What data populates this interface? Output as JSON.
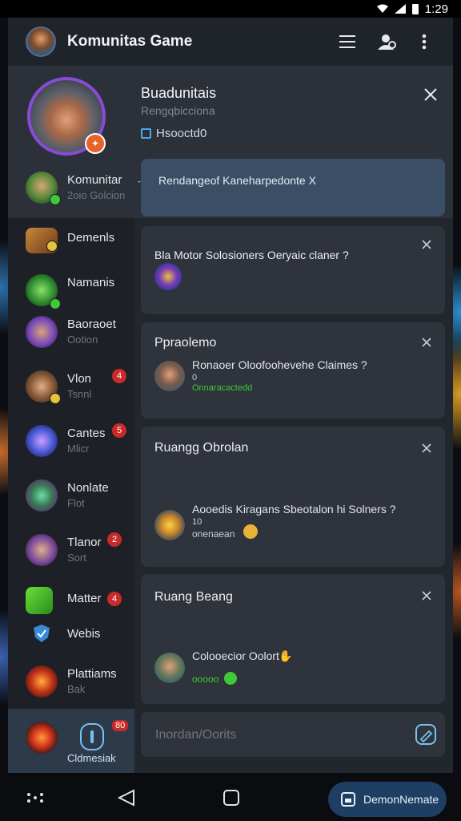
{
  "status_bar": {
    "time": "1:29"
  },
  "header": {
    "title": "Komunitas Game"
  },
  "profile": {
    "name": "Buadunitais",
    "subtitle": "Rengqbicciona",
    "check_label": "Hsooctd0"
  },
  "sidebar": {
    "selected": {
      "label": "Komunitar",
      "sub": "2oio Golcion"
    },
    "items": [
      {
        "label": "Demenls",
        "sub": ""
      },
      {
        "label": "Namanis",
        "sub": ""
      },
      {
        "label": "Baoraoet",
        "sub": "Ootion"
      },
      {
        "label": "Vlon",
        "sub": "Tsnnl",
        "count": "4"
      },
      {
        "label": "Cantes",
        "sub": "Mlicr",
        "count": "5"
      },
      {
        "label": "Nonlate",
        "sub": "Flot"
      },
      {
        "label": "Tlanor",
        "sub": "Sort",
        "count": "2"
      },
      {
        "label": "Matter",
        "sub": "",
        "count": "4"
      },
      {
        "label": "Webis",
        "sub": ""
      },
      {
        "label": "Plattiams",
        "sub": "Bak"
      }
    ],
    "bottom_tab": {
      "label": "Cldmesiak",
      "count": "80"
    }
  },
  "highlight": {
    "text": "Rendangeof Kaneharpedonte X"
  },
  "cards": [
    {
      "title": "Bla Motor Solosioners Oeryaic claner ?"
    },
    {
      "title": "Ppraolemo",
      "line": "Ronaoer Oloofoohevehe Claimes ?",
      "meta1": "0",
      "meta2": "Onnaracactedd"
    },
    {
      "title": "Ruangg Obrolan",
      "line": "Aooedis Kiragans Sbeotalon hi Solners ?",
      "meta1": "10",
      "meta2": "onenaean"
    },
    {
      "title": "Ruang Beang",
      "line": "Colooecior Oolort",
      "meta2": "ooooo"
    }
  ],
  "input": {
    "placeholder": "Inordan/Oorits"
  },
  "fab": {
    "label": "DemonNemate"
  },
  "colors": {
    "accent": "#3a4e66",
    "badge": "#c92a2a",
    "green": "#3ec93a",
    "fab": "#1e3e64"
  }
}
